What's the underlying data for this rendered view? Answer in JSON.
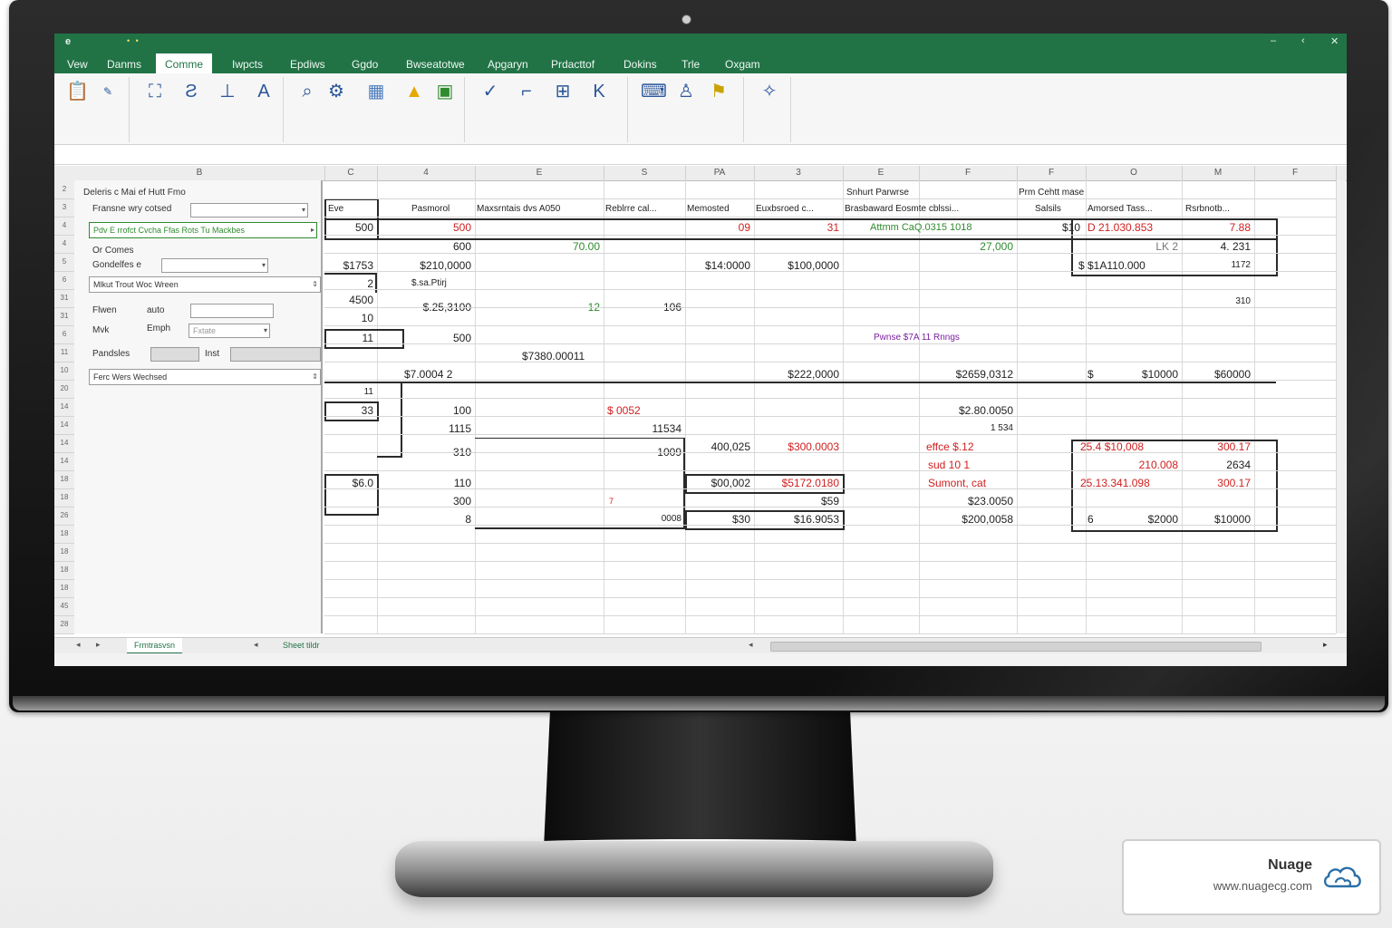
{
  "watermark": {
    "brand": "Nuage",
    "url": "www.nuagecg.com"
  },
  "window": {
    "tabs": [
      "Vew",
      "Danms",
      "Comme",
      "Iwpcts",
      "Epdiws",
      "Ggdo",
      "Bwseatotwe",
      "Apgaryn",
      "Prdacttof",
      "Dokins",
      "Trle",
      "Oxgam"
    ],
    "active_tab_index": 2
  },
  "panel": {
    "title": "Deleris c Mai ef Hutt Fmo",
    "field1_label": "Fransne wry cotsed",
    "highlight_input": "Pdv E rrofct Cvcha Ffas Rots Tu Mackbes",
    "label_or": "Or Comes",
    "label_conditions": "Gondelfes e",
    "select1": "Mlkut Trout Woc Wreen",
    "label_fiwen": "Flwen",
    "label_auto": "auto",
    "label_mvke": "Mvk",
    "label_emph": "Emph",
    "placeholder_small": "Fxtate",
    "label_pandsles": "Pandsles",
    "label_inst": "Inst",
    "select2": "Ferc Wers Wechsed"
  },
  "grid": {
    "col_headers": [
      "C",
      "4",
      "E",
      "S",
      "PA",
      "3",
      "E",
      "F",
      "F",
      "O",
      "M",
      "F"
    ],
    "row_numbers": [
      "2",
      "3",
      "4",
      "4",
      "5",
      "6",
      "31",
      "31",
      "6",
      "11",
      "10",
      "20",
      "14",
      "14",
      "14",
      "14",
      "18",
      "18",
      "26",
      "18",
      "18",
      "18",
      "18",
      "45",
      "28"
    ],
    "section1": "Snhurt Parwrse",
    "section2": "Prm Cehtt mase",
    "headers": [
      "Eve",
      "Pasmorol",
      "Maxsrntais dvs A050",
      "Reblrre cal...",
      "Memosted",
      "Euxbsroed c...",
      "Brasbaward Eosmte cblssi...",
      "Salsils",
      "Amorsed Tass...",
      "Rsrbnotb..."
    ],
    "r1": {
      "a": "500",
      "b": "500",
      "e": "09",
      "f": "31",
      "g": "Attmm CaQ.0315 1018",
      "h": "$10",
      "i": "D 21.030.853",
      "j": "7.88"
    },
    "r2": {
      "b": "600",
      "c": "70.00",
      "g2": "27,000",
      "i": "LK 2",
      "j": "4. 231"
    },
    "r3": {
      "a": "$1753",
      "b": "$210,0000",
      "e": "$14:0000",
      "f": "$100,0000",
      "i": "$   $1A110.000",
      "j": "1172"
    },
    "r4": {
      "a": "2",
      "b": "$.sa.Ptirj",
      "j": "310"
    },
    "r5": {
      "a": "4500",
      "a2": "10",
      "b": "$.25,3100",
      "c": "12",
      "d": "106"
    },
    "r6": {
      "a": "11",
      "b": "500",
      "g": "Pwnse $7A 11 Rnngs"
    },
    "r7": {
      "c": "$7380.00011"
    },
    "r8": {
      "b": "$7.0004 2",
      "f": "$222,0000",
      "g": "$2659,0312",
      "i": "$",
      "i2": "$10000",
      "j": "$60000"
    },
    "r9": {
      "a": "11"
    },
    "r10": {
      "a": "33",
      "b": "100",
      "d": "$   0052",
      "g": "$2.80.0050"
    },
    "r11": {
      "b": "1115",
      "d": "11534",
      "g": "1 534"
    },
    "r12": {
      "b": "310",
      "d": "1009",
      "e": "400,025",
      "f": "$300.0003",
      "g": "effce $.12",
      "i": "25.4 $10,008",
      "j": "300.17"
    },
    "r13": {
      "g": "sud 10   1",
      "i": "210.008",
      "j": "2634"
    },
    "r14": {
      "a": "$6.0",
      "b": "110",
      "e": "$00,002",
      "f": "$5172.0180",
      "g": "Sumont, cat",
      "i": "25.13.341.098",
      "j": "300.17"
    },
    "r15": {
      "b": "300",
      "d0": "7",
      "f": "$59",
      "g": "$23.0050"
    },
    "r16": {
      "b": "8",
      "d": "0008",
      "e": "$30",
      "f": "$16.9053",
      "g": "$200,0058",
      "i": "6",
      "i2": "$2000",
      "j": "$10000"
    }
  },
  "sheets": [
    "Frmtrasvsn",
    "Sheet tildr"
  ]
}
